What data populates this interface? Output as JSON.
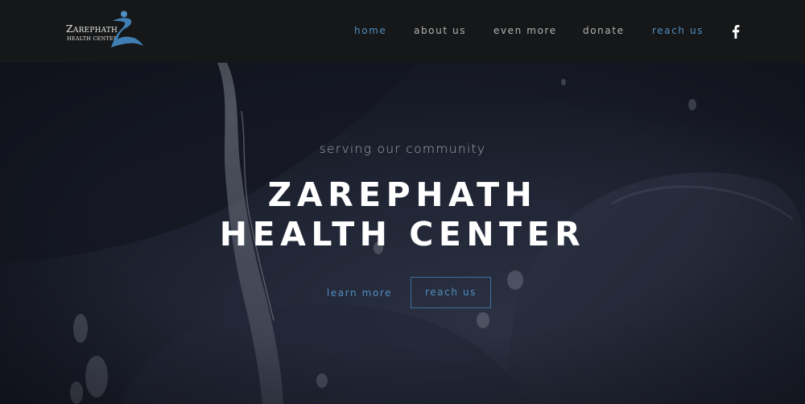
{
  "brand": {
    "name_line1": "Zarephath",
    "name_line2": "HEALTH CENTER",
    "accent_color": "#4f8ec2"
  },
  "nav": {
    "items": [
      {
        "label": "home",
        "active": true
      },
      {
        "label": "about us"
      },
      {
        "label": "even more"
      },
      {
        "label": "donate"
      },
      {
        "label": "reach us",
        "highlight": true
      }
    ],
    "social_icon": "facebook-icon"
  },
  "hero": {
    "tagline": "serving our community",
    "title_line1": "ZAREPHATH",
    "title_line2": "HEALTH CENTER",
    "buttons": {
      "learn_more": "learn more",
      "reach_us": "reach us"
    }
  }
}
